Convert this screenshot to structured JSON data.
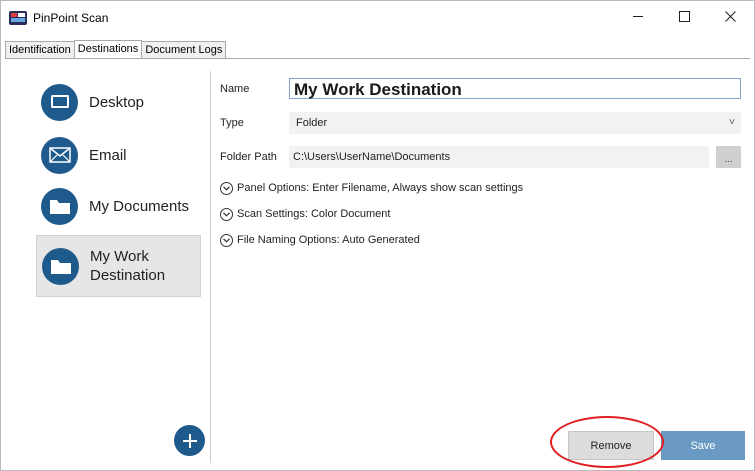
{
  "window": {
    "title": "PinPoint Scan",
    "minimize_label": "—",
    "maximize_label": "☐",
    "close_label": "✕"
  },
  "tabs": [
    {
      "label": "Identification",
      "active": false
    },
    {
      "label": "Destinations",
      "active": true
    },
    {
      "label": "Document Logs",
      "active": false
    }
  ],
  "sidebar": {
    "items": [
      {
        "label": "Desktop",
        "icon": "monitor-icon",
        "selected": false
      },
      {
        "label": "Email",
        "icon": "envelope-icon",
        "selected": false
      },
      {
        "label": "My Documents",
        "icon": "folder-icon",
        "selected": false
      },
      {
        "label": "My Work Destination",
        "icon": "folder-icon",
        "selected": true
      }
    ],
    "add_icon": "plus-icon"
  },
  "form": {
    "name_label": "Name",
    "name_value": "My Work Destination",
    "type_label": "Type",
    "type_value": "Folder",
    "folder_path_label": "Folder Path",
    "folder_path_value": "C:\\Users\\UserName\\Documents",
    "browse_label": "...",
    "options": [
      {
        "label": "Panel Options: Enter Filename, Always show scan settings"
      },
      {
        "label": "Scan Settings: Color Document"
      },
      {
        "label": "File Naming Options: Auto Generated"
      }
    ]
  },
  "actions": {
    "remove_label": "Remove",
    "save_label": "Save"
  },
  "colors": {
    "accent": "#1f5a8c",
    "save_button": "#6a99c4",
    "highlight": "#e02020"
  }
}
